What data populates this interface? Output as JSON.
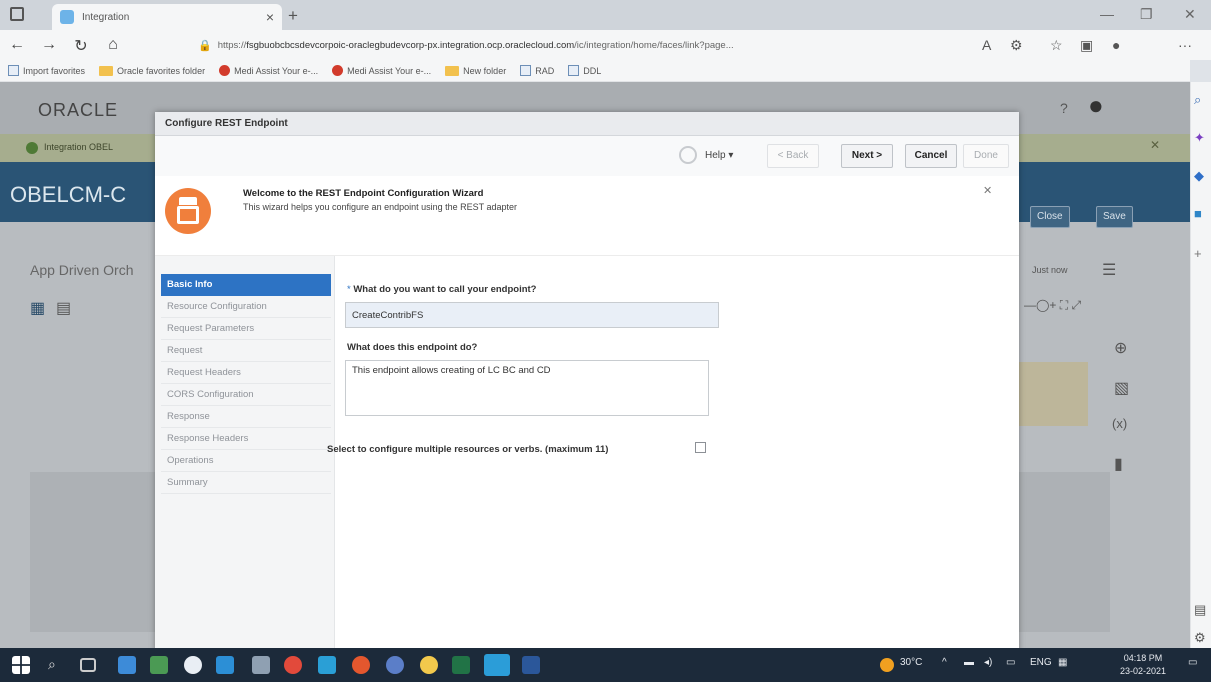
{
  "browser": {
    "tab_title": "Integration",
    "url_scheme": "https://",
    "url_host": "fsgbuobcbcsdevcorpoic-oraclegbudevcorp-px.integration.ocp.oraclecloud.com",
    "url_path": "/ic/integration/home/faces/link?page...",
    "favorites": [
      {
        "label": "Import favorites"
      },
      {
        "label": "Oracle favorites folder"
      },
      {
        "label": "Medi Assist Your e-..."
      },
      {
        "label": "Medi Assist Your e-..."
      },
      {
        "label": "New folder"
      },
      {
        "label": "RAD"
      },
      {
        "label": "DDL"
      }
    ]
  },
  "app": {
    "logo": "ORACLE",
    "banner_text": "Integration OBEL",
    "title": "OBELCM-C",
    "close_label": "Close",
    "save_label": "Save",
    "subtitle": "App Driven Orch",
    "just_now": "Just now"
  },
  "dialog": {
    "title": "Configure REST Endpoint",
    "toolbar": {
      "help_label": "Help ▾",
      "back_label": "< Back",
      "next_label": "Next >",
      "cancel_label": "Cancel",
      "done_label": "Done"
    },
    "welcome": {
      "title": "Welcome to the REST Endpoint Configuration Wizard",
      "description": "This wizard helps you configure an endpoint using the REST adapter"
    },
    "steps": [
      {
        "label": "Basic Info",
        "active": true
      },
      {
        "label": "Resource Configuration"
      },
      {
        "label": "Request Parameters"
      },
      {
        "label": "Request"
      },
      {
        "label": "Request Headers"
      },
      {
        "label": "CORS Configuration"
      },
      {
        "label": "Response"
      },
      {
        "label": "Response Headers"
      },
      {
        "label": "Operations"
      },
      {
        "label": "Summary"
      }
    ],
    "form": {
      "name_question": "What do you want to call your endpoint?",
      "name_value": "CreateContribFS",
      "desc_question": "What does this endpoint do?",
      "desc_value": "This endpoint allows creating of LC BC and CD",
      "multi_label": "Select to configure multiple resources or verbs. (maximum 11)",
      "multi_checked": false
    }
  },
  "taskbar": {
    "temperature": "30°C",
    "language": "ENG",
    "time": "04:18 PM",
    "date": "23-02-2021"
  },
  "colors": {
    "accent": "#2d73c4",
    "wizard_icon": "#f07f3c",
    "app_titlebar": "#2a5475"
  }
}
